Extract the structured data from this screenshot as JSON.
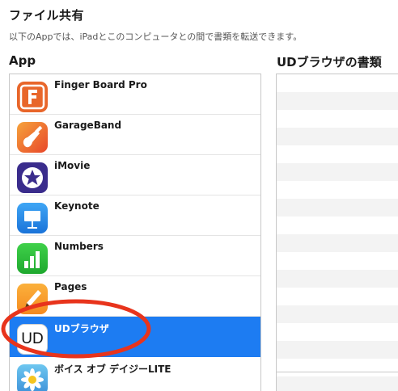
{
  "section": {
    "title": "ファイル共有",
    "subtitle": "以下のAppでは、iPadとこのコンピュータとの間で書類を転送できます。"
  },
  "apps_header": "App",
  "documents_header": "UDブラウザの書類",
  "apps": [
    {
      "name": "Finger Board Pro",
      "icon": "finger-board-pro-icon",
      "selected": false
    },
    {
      "name": "GarageBand",
      "icon": "garageband-icon",
      "selected": false
    },
    {
      "name": "iMovie",
      "icon": "imovie-icon",
      "selected": false
    },
    {
      "name": "Keynote",
      "icon": "keynote-icon",
      "selected": false
    },
    {
      "name": "Numbers",
      "icon": "numbers-icon",
      "selected": false
    },
    {
      "name": "Pages",
      "icon": "pages-icon",
      "selected": false
    },
    {
      "name": "UDブラウザ",
      "icon": "ud-browser-icon",
      "icon_text": "UD",
      "selected": true
    },
    {
      "name": "ボイス オブ デイジーLITE",
      "icon": "voice-of-daisy-icon",
      "selected": false
    }
  ],
  "colors": {
    "selection": "#1d7cf2",
    "annotation": "#e8341c"
  }
}
